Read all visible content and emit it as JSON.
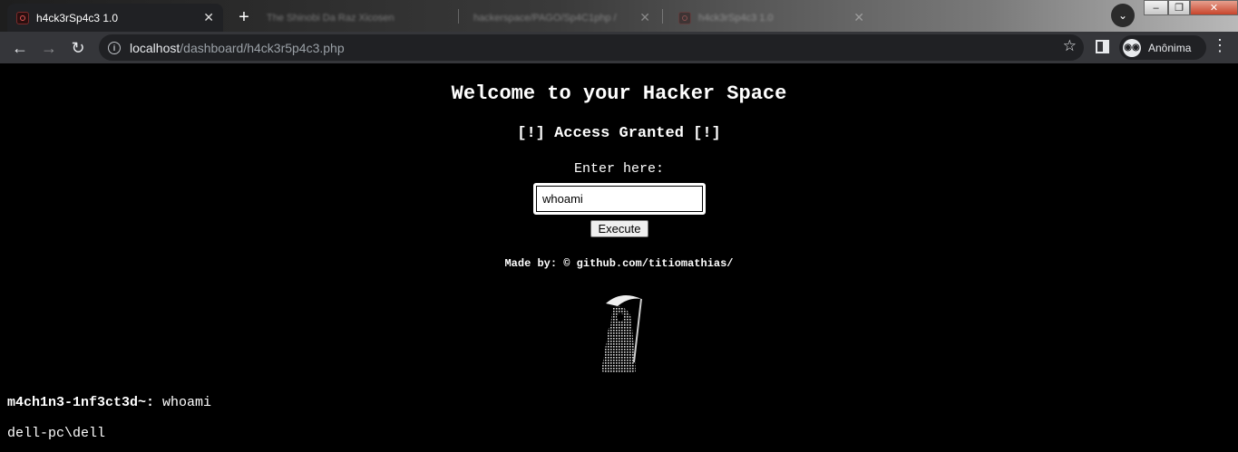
{
  "browser": {
    "active_tab": {
      "title": "h4ck3rSp4c3 1.0",
      "favicon": "skull-favicon"
    },
    "inactive_tabs": [
      {
        "title": "The Shinobi Da Raz Xicosen"
      },
      {
        "title": "hackerspace/PAGO/Sp4C1php /"
      },
      {
        "title": "h4ck3rSp4c3 1.0"
      }
    ],
    "url_host": "localhost",
    "url_path": "/dashboard/h4ck3r5p4c3.php",
    "profile_label": "Anônima",
    "icons": [
      "back-icon",
      "forward-icon",
      "reload-icon",
      "info-icon",
      "star-icon",
      "side-panel-icon",
      "incognito-icon",
      "menu-icon",
      "new-tab-icon",
      "tab-search-icon"
    ]
  },
  "page": {
    "title": "Welcome to your Hacker Space",
    "status": "[!] Access Granted [!]",
    "enter_label": "Enter here:",
    "command_value": "whoami",
    "execute_label": "Execute",
    "made_by": "Made by: © github.com/titiomathias/",
    "prompt_host": "m4ch1n3-1nf3ct3d~:",
    "prompt_command": "whoami",
    "output": "dell-pc\\dell"
  }
}
